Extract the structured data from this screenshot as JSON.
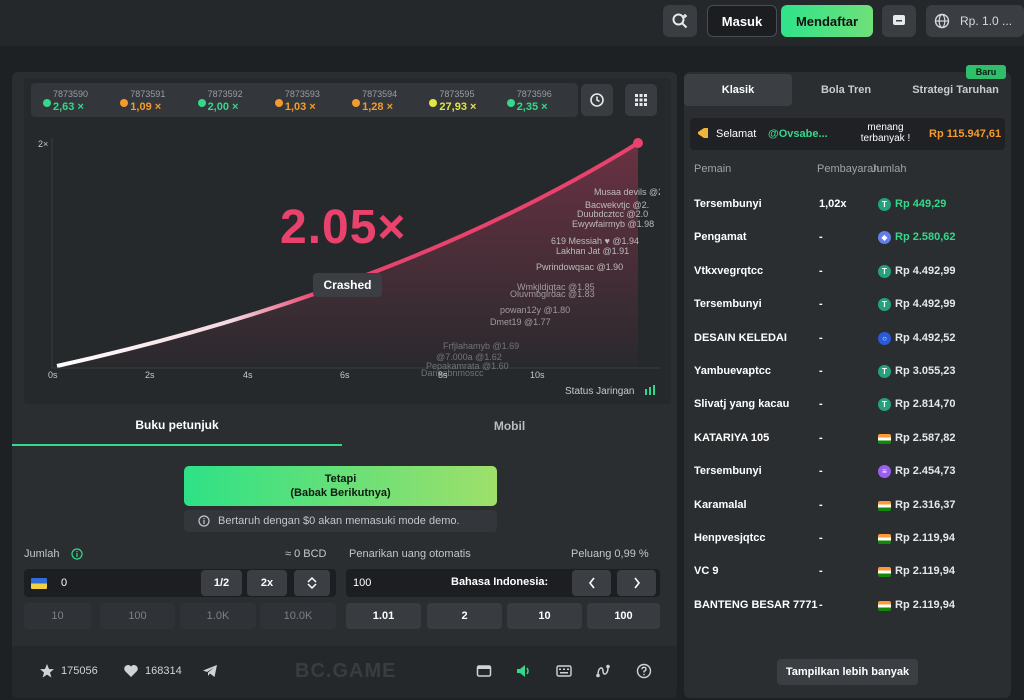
{
  "topbar": {
    "login_label": "Masuk",
    "register_label": "Mendaftar",
    "currency_label": "Rp. 1.0 ..."
  },
  "history": [
    {
      "id": "7873590",
      "value": "2,63 ×",
      "color": "#34d88a"
    },
    {
      "id": "7873591",
      "value": "1,09 ×",
      "color": "#f59b2b"
    },
    {
      "id": "7873592",
      "value": "2,00 ×",
      "color": "#34d88a"
    },
    {
      "id": "7873593",
      "value": "1,03 ×",
      "color": "#f59b2b"
    },
    {
      "id": "7873594",
      "value": "1,28 ×",
      "color": "#f59b2b"
    },
    {
      "id": "7873595",
      "value": "27,93 ×",
      "color": "#e4e542"
    },
    {
      "id": "7873596",
      "value": "2,35 ×",
      "color": "#34d88a"
    }
  ],
  "game": {
    "multiplier": "2.05×",
    "status": "Crashed",
    "y_label": "2×",
    "x_ticks": [
      "0s",
      "2s",
      "4s",
      "6s",
      "8s",
      "10s"
    ],
    "network_label": "Status Jaringan",
    "cashouts": [
      "Musaa devils @2.",
      "Bacwekvtjc @2.",
      "Duubdcztcc @2.0",
      "Ewywfairmyb @1.98",
      "619 Messiah ♥ @1.94",
      "Lakhan Jat @1.91",
      "Pwrindowqsac @1.90",
      "Wmkjldjqtac @1.85",
      "Oluvmbgirdac @1.83",
      "powan12y @1.80",
      "Dmet19 @1.77",
      "Frfjlahamyb @1.69",
      "@7.000a @1.62",
      "Pepakamrata @1.60",
      "Daneabnmoscc"
    ]
  },
  "tabs": {
    "manual": "Buku petunjuk",
    "mobile": "Mobil"
  },
  "bet": {
    "button_line1": "Tetapi",
    "button_line2": "(Babak Berikutnya)",
    "demo_note": "Bertaruh dengan $0 akan memasuki mode demo.",
    "amount_label": "Jumlah",
    "amount_bcd": "≈ 0 BCD",
    "amount_value": "0",
    "half": "1/2",
    "double": "2x",
    "presets": [
      "10",
      "100",
      "1.0K",
      "10.0K"
    ],
    "autocash_label": "Penarikan uang otomatis",
    "chance_label": "Peluang 0,99 %",
    "autocash_value": "100",
    "lang_label": "Bahasa Indonesia:",
    "auto_presets": [
      "1.01",
      "2",
      "10",
      "100"
    ]
  },
  "footer": {
    "stars": "175056",
    "likes": "168314",
    "logo": "BC.GAME"
  },
  "right": {
    "tabs": [
      "Klasik",
      "Bola Tren",
      "Strategi Taruhan"
    ],
    "new_badge": "Baru",
    "congrats_label": "Selamat",
    "congrats_user": "@Ovsabe...",
    "congrats_mid": "menang terbanyak !",
    "congrats_amount": "Rp 115.947,61",
    "col_player": "Pemain",
    "col_payout": "Pembayaran",
    "col_amount": "Jumlah",
    "rows": [
      {
        "name": "Tersembunyi",
        "mult": "1,02x",
        "amount": "Rp 449,29",
        "coin": "T",
        "coin_color": "#26a17b",
        "amount_color": "#34d88a"
      },
      {
        "name": "Pengamat",
        "mult": "-",
        "amount": "Rp 2.580,62",
        "coin": "◆",
        "coin_color": "#627eea",
        "amount_color": "#34d88a"
      },
      {
        "name": "Vtkxvegrqtcc",
        "mult": "-",
        "amount": "Rp 4.492,99",
        "coin": "T",
        "coin_color": "#26a17b",
        "amount_color": "#e6e7e8"
      },
      {
        "name": "Tersembunyi",
        "mult": "-",
        "amount": "Rp 4.492,99",
        "coin": "T",
        "coin_color": "#26a17b",
        "amount_color": "#e6e7e8"
      },
      {
        "name": "DESAIN KELEDAI",
        "mult": "-",
        "amount": "Rp 4.492,52",
        "coin": "○",
        "coin_color": "#2a5ada",
        "amount_color": "#e6e7e8"
      },
      {
        "name": "Yambuevaptcc",
        "mult": "-",
        "amount": "Rp 3.055,23",
        "coin": "T",
        "coin_color": "#26a17b",
        "amount_color": "#e6e7e8"
      },
      {
        "name": "Slivatj yang kacau",
        "mult": "-",
        "amount": "Rp 2.814,70",
        "coin": "T",
        "coin_color": "#26a17b",
        "amount_color": "#e6e7e8"
      },
      {
        "name": "KATARIYA 105",
        "mult": "-",
        "amount": "Rp 2.587,82",
        "coin": "flag",
        "coin_color": "",
        "amount_color": "#e6e7e8"
      },
      {
        "name": "Tersembunyi",
        "mult": "-",
        "amount": "Rp 2.454,73",
        "coin": "≡",
        "coin_color": "#9a5ff0",
        "amount_color": "#e6e7e8"
      },
      {
        "name": "Karamalal",
        "mult": "-",
        "amount": "Rp 2.316,37",
        "coin": "flag",
        "coin_color": "",
        "amount_color": "#e6e7e8"
      },
      {
        "name": "Henpvesjqtcc",
        "mult": "-",
        "amount": "Rp 2.119,94",
        "coin": "flag",
        "coin_color": "",
        "amount_color": "#e6e7e8"
      },
      {
        "name": "VC 9",
        "mult": "-",
        "amount": "Rp 2.119,94",
        "coin": "flag",
        "coin_color": "",
        "amount_color": "#e6e7e8"
      },
      {
        "name": "BANTENG BESAR 7771",
        "mult": "-",
        "amount": "Rp 2.119,94",
        "coin": "flag",
        "coin_color": "",
        "amount_color": "#e6e7e8"
      }
    ],
    "more_label": "Tampilkan lebih banyak"
  }
}
